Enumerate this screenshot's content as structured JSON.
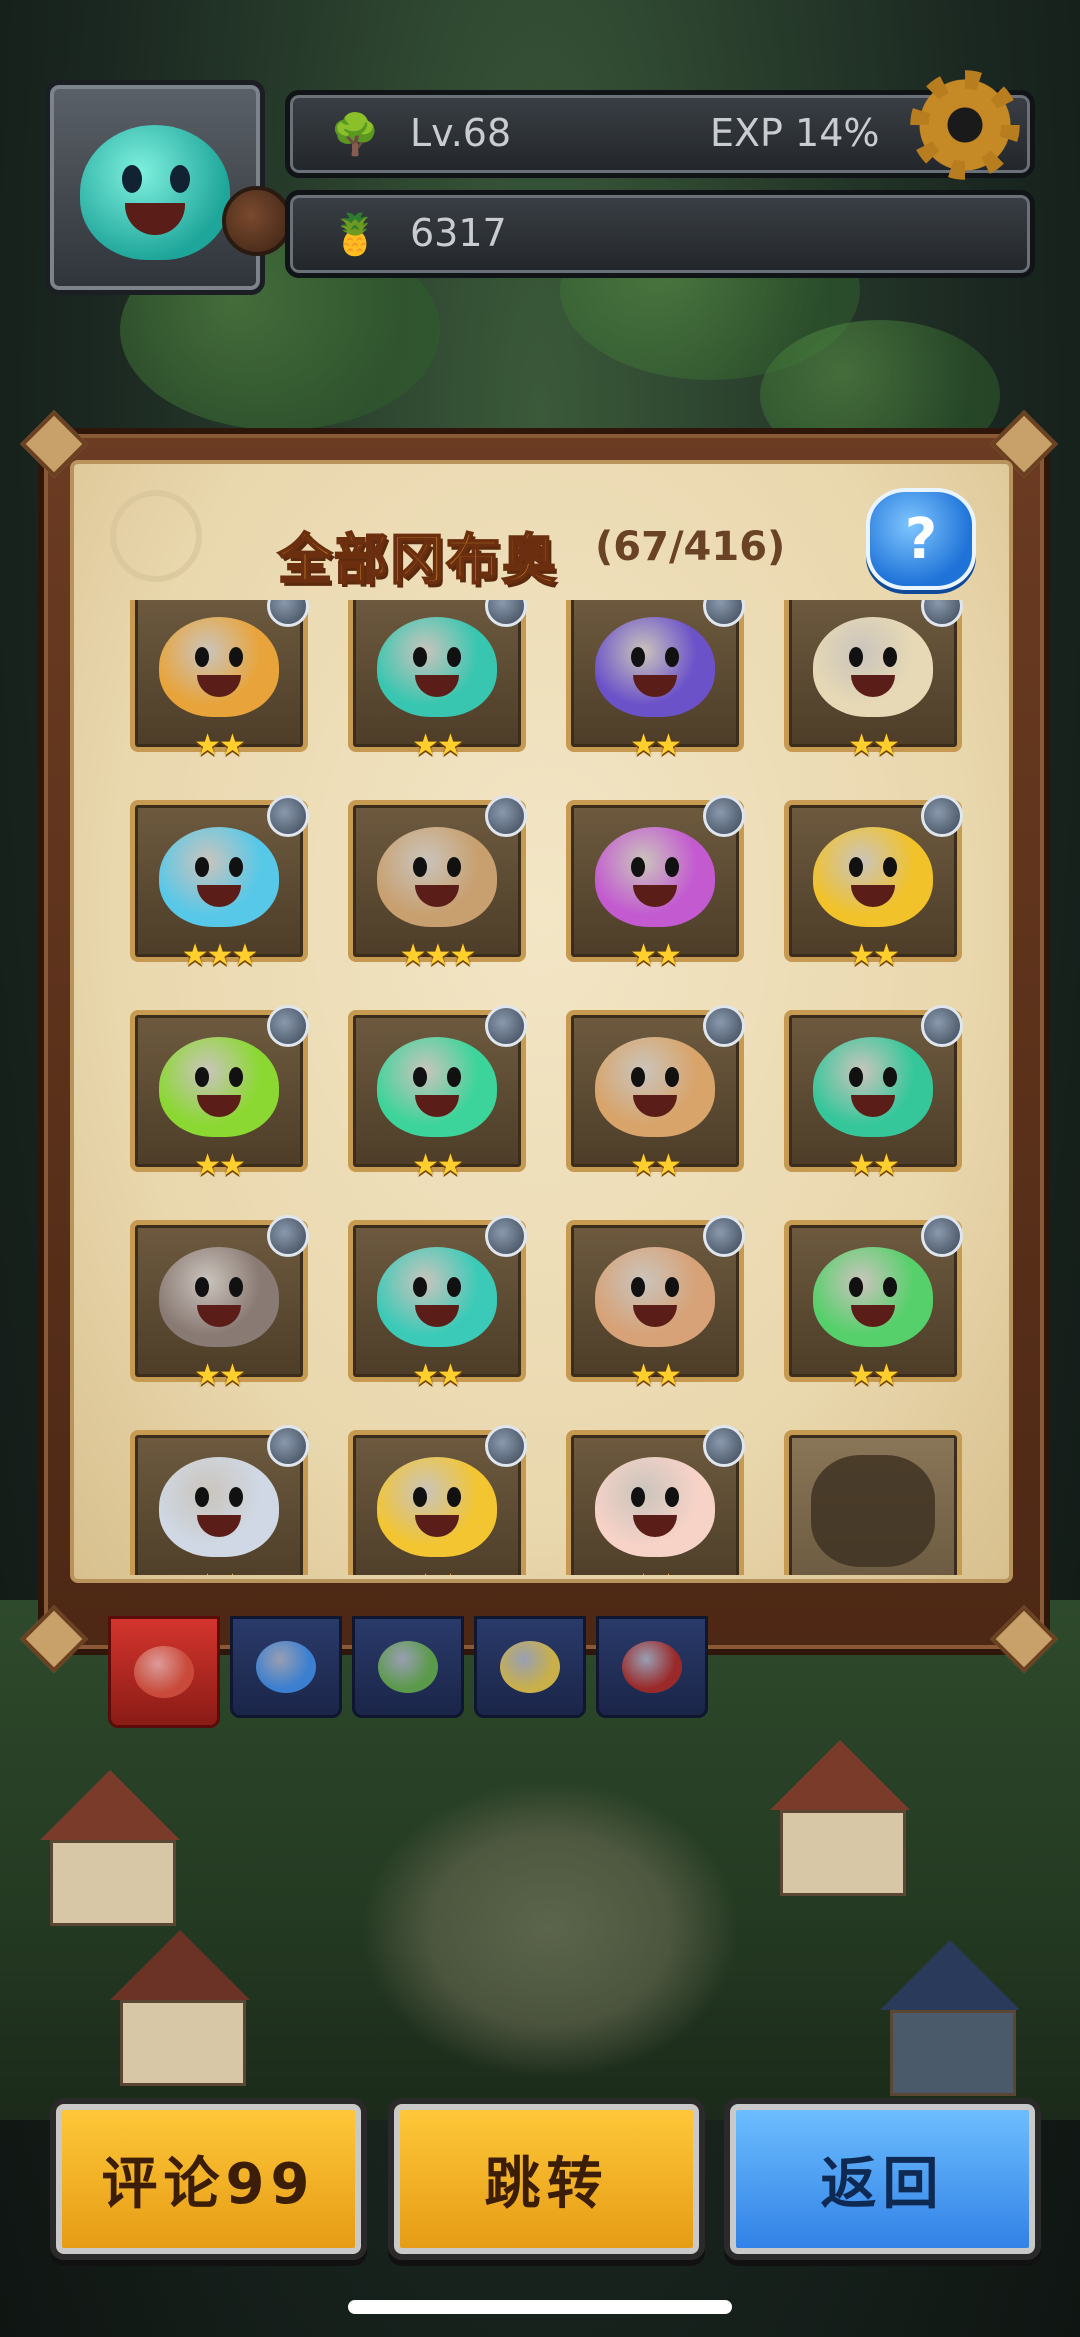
{
  "hud": {
    "level": "Lv.68",
    "exp": "EXP 14%",
    "gold": "6317",
    "level_icon": "tree-icon",
    "gold_icon": "fruit-icon",
    "settings_icon": "gear-icon"
  },
  "panel": {
    "title": "全部冈布奥",
    "count": "(67/416)",
    "help_label": "?"
  },
  "collection": [
    {
      "stars": "★★",
      "color": "#e8a43a"
    },
    {
      "stars": "★★",
      "color": "#38c6b0"
    },
    {
      "stars": "★★",
      "color": "#6b52c9"
    },
    {
      "stars": "★★",
      "color": "#e7d9b5"
    },
    {
      "stars": "★★★",
      "color": "#58c8e8"
    },
    {
      "stars": "★★★",
      "color": "#c8a070"
    },
    {
      "stars": "★★",
      "color": "#c35ad0"
    },
    {
      "stars": "★★",
      "color": "#f1c22a"
    },
    {
      "stars": "★★",
      "color": "#8bd832"
    },
    {
      "stars": "★★",
      "color": "#3cd49a"
    },
    {
      "stars": "★★",
      "color": "#d8a46a"
    },
    {
      "stars": "★★",
      "color": "#35c79a"
    },
    {
      "stars": "★★",
      "color": "#8a7a74"
    },
    {
      "stars": "★★",
      "color": "#3ccab8"
    },
    {
      "stars": "★★",
      "color": "#d7a277"
    },
    {
      "stars": "★★",
      "color": "#55d06a"
    },
    {
      "stars": "★★",
      "color": "#cfd8e4"
    },
    {
      "stars": "★★",
      "color": "#f2c531"
    },
    {
      "stars": "★★",
      "color": "#f6d2c7"
    },
    {
      "stars": "",
      "color": "locked"
    }
  ],
  "tabs": [
    {
      "name": "all",
      "color": "#c94a3a"
    },
    {
      "name": "water",
      "color": "#3b7fd0"
    },
    {
      "name": "nature",
      "color": "#5b9a4a"
    },
    {
      "name": "light",
      "color": "#c9b04a"
    },
    {
      "name": "dark",
      "color": "#9a2a2a"
    }
  ],
  "buttons": {
    "review": "评论99",
    "jump": "跳转",
    "back": "返回"
  }
}
